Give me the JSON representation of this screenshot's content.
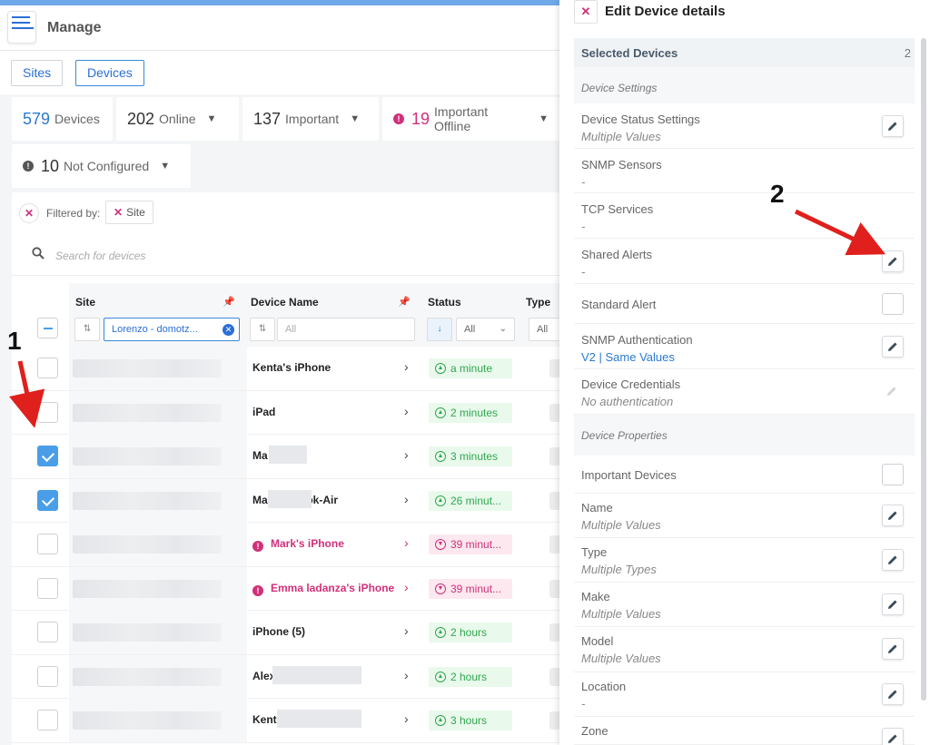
{
  "header": {
    "title": "Manage"
  },
  "tabs": [
    {
      "label": "Sites"
    },
    {
      "label": "Devices"
    }
  ],
  "stats": {
    "devices": {
      "num": "579",
      "label": "Devices"
    },
    "online": {
      "num": "202",
      "label": "Online"
    },
    "important": {
      "num": "137",
      "label": "Important"
    },
    "important_offline": {
      "num": "19",
      "label": "Important Offline"
    },
    "not_configured": {
      "num": "10",
      "label": "Not Configured"
    }
  },
  "filter": {
    "label": "Filtered by:",
    "chip": "Site"
  },
  "search": {
    "placeholder": "Search for devices"
  },
  "columns": {
    "site": "Site",
    "device_name": "Device Name",
    "status": "Status",
    "type": "Type",
    "site_filter": "Lorenzo - domotz...",
    "name_filter_placeholder": "All",
    "status_filter": "All",
    "type_filter": "All"
  },
  "rows": [
    {
      "name": "Kenta's iPhone",
      "status": "a minute",
      "state": "online",
      "checked": false
    },
    {
      "name": "iPad",
      "status": "2 minutes",
      "state": "online",
      "checked": false
    },
    {
      "name": "Ma         iPhone",
      "status": "3 minutes",
      "state": "online",
      "checked": true
    },
    {
      "name": "Ma         MacBook-Air",
      "status": "26 minut...",
      "state": "online",
      "checked": true
    },
    {
      "name": "Mark's iPhone",
      "status": "39 minut...",
      "state": "offline",
      "checked": false
    },
    {
      "name": "Emma ladanza's iPhone",
      "status": "39 minut...",
      "state": "offline",
      "checked": false
    },
    {
      "name": "iPhone (5)",
      "status": "2 hours",
      "state": "online",
      "checked": false
    },
    {
      "name": "Alex",
      "status": "2 hours",
      "state": "online",
      "checked": false
    },
    {
      "name": "Kent",
      "status": "3 hours",
      "state": "online",
      "checked": false
    }
  ],
  "panel": {
    "title": "Edit Device details",
    "selected_label": "Selected Devices",
    "selected_count": "2",
    "device_settings": "Device Settings",
    "device_properties": "Device Properties",
    "settings": [
      {
        "label": "Device Status Settings",
        "value": "Multiple Values"
      },
      {
        "label": "SNMP Sensors",
        "value": "-"
      },
      {
        "label": "TCP Services",
        "value": "-"
      },
      {
        "label": "Shared Alerts",
        "value": "-"
      },
      {
        "label": "Standard Alert",
        "value": ""
      },
      {
        "label": "SNMP Authentication",
        "value": "V2 | Same Values"
      },
      {
        "label": "Device Credentials",
        "value": "No authentication"
      }
    ],
    "properties": [
      {
        "label": "Important Devices",
        "value": ""
      },
      {
        "label": "Name",
        "value": "Multiple Values"
      },
      {
        "label": "Type",
        "value": "Multiple Types"
      },
      {
        "label": "Make",
        "value": "Multiple Values"
      },
      {
        "label": "Model",
        "value": "Multiple Values"
      },
      {
        "label": "Location",
        "value": "-"
      },
      {
        "label": "Zone",
        "value": ""
      }
    ]
  },
  "annotations": {
    "one": "1",
    "two": "2"
  },
  "colors": {
    "accent": "#2b6fd6",
    "alert": "#d0307a",
    "online": "#2fa84f"
  }
}
